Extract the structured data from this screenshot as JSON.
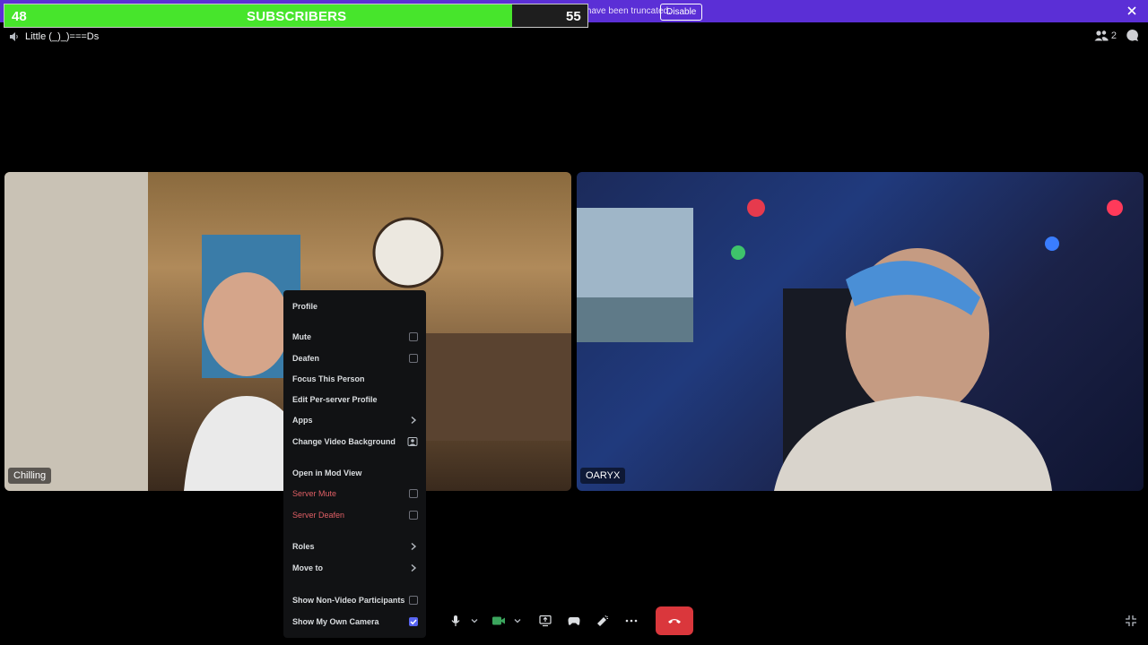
{
  "banner": {
    "text": "abled. Usernames have been truncated.",
    "button_label": "Disable",
    "bg_color": "#5b2fd6"
  },
  "subscriber_goal": {
    "current": "48",
    "label": "SUBSCRIBERS",
    "goal": "55",
    "progress": 0.87,
    "fill_color": "#47e52c"
  },
  "channel": {
    "name": "Little (_)_)===Ds"
  },
  "top_right": {
    "participants_count": "2"
  },
  "tiles": [
    {
      "label": "Chilling"
    },
    {
      "label": "OARYX"
    }
  ],
  "context_menu": {
    "items": [
      {
        "label": "Profile"
      },
      {
        "label": "Mute",
        "control": "checkbox",
        "checked": false
      },
      {
        "label": "Deafen",
        "control": "checkbox",
        "checked": false
      },
      {
        "label": "Focus This Person"
      },
      {
        "label": "Edit Per-server Profile"
      },
      {
        "label": "Apps",
        "control": "chevron"
      },
      {
        "label": "Change Video Background",
        "control": "icon"
      },
      {
        "label": "Open in Mod View"
      },
      {
        "label": "Server Mute",
        "control": "checkbox",
        "checked": false,
        "danger": true
      },
      {
        "label": "Server Deafen",
        "control": "checkbox",
        "checked": false,
        "danger": true
      },
      {
        "label": "Roles",
        "control": "chevron"
      },
      {
        "label": "Move to",
        "control": "chevron"
      },
      {
        "label": "Show Non-Video Participants",
        "control": "checkbox",
        "checked": false
      },
      {
        "label": "Show My Own Camera",
        "control": "checkbox",
        "checked": true
      }
    ]
  },
  "controls": {
    "buttons": [
      "mic-icon",
      "chevron-down-icon",
      "camera-icon",
      "chevron-down-icon",
      "screen-share-icon",
      "activity-icon",
      "soundboard-icon",
      "more-icon"
    ],
    "hangup": "phone-hangup-icon"
  },
  "colors": {
    "accent": "#5865f2",
    "danger": "#e05f65",
    "hangup": "#da373c"
  }
}
